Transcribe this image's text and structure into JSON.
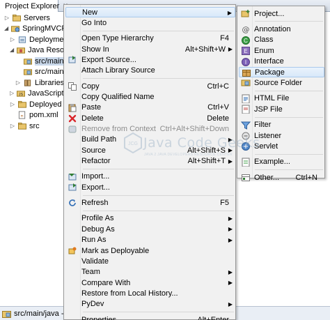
{
  "explorer": {
    "tab_title": "Project Explorer",
    "tree": [
      {
        "label": "Servers",
        "icon": "folder-icon",
        "indent": 0,
        "twisty": "closed"
      },
      {
        "label": "SpringMVCRed",
        "icon": "web-project-icon",
        "indent": 0,
        "twisty": "open"
      },
      {
        "label": "Deploymen",
        "icon": "deployment-icon",
        "indent": 1,
        "twisty": "closed"
      },
      {
        "label": "Java Resour",
        "icon": "java-resources-icon",
        "indent": 1,
        "twisty": "open"
      },
      {
        "label": "src/main/",
        "icon": "source-folder-icon",
        "indent": 2,
        "twisty": "none",
        "selected": true
      },
      {
        "label": "src/main/",
        "icon": "source-folder-icon",
        "indent": 2,
        "twisty": "none"
      },
      {
        "label": "Libraries",
        "icon": "libraries-icon",
        "indent": 2,
        "twisty": "closed"
      },
      {
        "label": "JavaScript R",
        "icon": "javascript-icon",
        "indent": 1,
        "twisty": "closed"
      },
      {
        "label": "Deployed R",
        "icon": "folder-icon",
        "indent": 1,
        "twisty": "closed"
      },
      {
        "label": "pom.xml",
        "icon": "xml-file-icon",
        "indent": 1,
        "twisty": "none"
      },
      {
        "label": "src",
        "icon": "folder-icon",
        "indent": 1,
        "twisty": "closed"
      }
    ],
    "status_text": "src/main/java - Spring"
  },
  "context_menu": {
    "items": [
      {
        "label": "New",
        "accel": "",
        "submenu": true,
        "highlighted": true,
        "icon": ""
      },
      {
        "label": "Go Into",
        "accel": "",
        "icon": ""
      },
      {
        "sep": true
      },
      {
        "label": "Open Type Hierarchy",
        "accel": "F4",
        "icon": ""
      },
      {
        "label": "Show In",
        "accel": "Alt+Shift+W",
        "submenu": true,
        "icon": ""
      },
      {
        "label": "Export Source...",
        "accel": "",
        "icon": "export-source-icon"
      },
      {
        "label": "Attach Library Source",
        "accel": "",
        "icon": ""
      },
      {
        "sep": true
      },
      {
        "label": "Copy",
        "accel": "Ctrl+C",
        "icon": "copy-icon"
      },
      {
        "label": "Copy Qualified Name",
        "accel": "",
        "icon": ""
      },
      {
        "label": "Paste",
        "accel": "Ctrl+V",
        "icon": "paste-icon"
      },
      {
        "label": "Delete",
        "accel": "Delete",
        "icon": "delete-icon"
      },
      {
        "label": "Remove from Context",
        "accel": "Ctrl+Alt+Shift+Down",
        "disabled": true,
        "icon": "remove-context-icon"
      },
      {
        "label": "Build Path",
        "accel": "",
        "submenu": true,
        "icon": ""
      },
      {
        "label": "Source",
        "accel": "Alt+Shift+S",
        "submenu": true,
        "icon": ""
      },
      {
        "label": "Refactor",
        "accel": "Alt+Shift+T",
        "submenu": true,
        "icon": ""
      },
      {
        "sep": true
      },
      {
        "label": "Import...",
        "accel": "",
        "icon": "import-icon"
      },
      {
        "label": "Export...",
        "accel": "",
        "icon": "export-icon"
      },
      {
        "sep": true
      },
      {
        "label": "Refresh",
        "accel": "F5",
        "icon": "refresh-icon"
      },
      {
        "sep": true
      },
      {
        "label": "Profile As",
        "accel": "",
        "submenu": true,
        "icon": ""
      },
      {
        "label": "Debug As",
        "accel": "",
        "submenu": true,
        "icon": ""
      },
      {
        "label": "Run As",
        "accel": "",
        "submenu": true,
        "icon": ""
      },
      {
        "label": "Mark as Deployable",
        "accel": "",
        "icon": "deployable-icon"
      },
      {
        "label": "Validate",
        "accel": "",
        "icon": ""
      },
      {
        "label": "Team",
        "accel": "",
        "submenu": true,
        "icon": ""
      },
      {
        "label": "Compare With",
        "accel": "",
        "submenu": true,
        "icon": ""
      },
      {
        "label": "Restore from Local History...",
        "accel": "",
        "icon": ""
      },
      {
        "label": "PyDev",
        "accel": "",
        "submenu": true,
        "icon": ""
      },
      {
        "sep": true
      },
      {
        "label": "Properties",
        "accel": "Alt+Enter",
        "icon": ""
      }
    ]
  },
  "new_submenu": {
    "items": [
      {
        "label": "Project...",
        "accel": "",
        "icon": "project-icon"
      },
      {
        "sep": true
      },
      {
        "label": "Annotation",
        "accel": "",
        "icon": "annotation-icon"
      },
      {
        "label": "Class",
        "accel": "",
        "icon": "class-icon"
      },
      {
        "label": "Enum",
        "accel": "",
        "icon": "enum-icon"
      },
      {
        "label": "Interface",
        "accel": "",
        "icon": "interface-icon"
      },
      {
        "label": "Package",
        "accel": "",
        "icon": "package-icon",
        "highlighted": true
      },
      {
        "label": "Source Folder",
        "accel": "",
        "icon": "source-folder-icon"
      },
      {
        "sep": true
      },
      {
        "label": "HTML File",
        "accel": "",
        "icon": "html-file-icon"
      },
      {
        "label": "JSP File",
        "accel": "",
        "icon": "jsp-file-icon"
      },
      {
        "sep": true
      },
      {
        "label": "Filter",
        "accel": "",
        "icon": "filter-icon"
      },
      {
        "label": "Listener",
        "accel": "",
        "icon": "listener-icon"
      },
      {
        "label": "Servlet",
        "accel": "",
        "icon": "servlet-icon"
      },
      {
        "sep": true
      },
      {
        "label": "Example...",
        "accel": "",
        "icon": "example-icon"
      },
      {
        "sep": true
      },
      {
        "label": "Other...",
        "accel": "Ctrl+N",
        "icon": "other-icon"
      }
    ]
  },
  "watermark": {
    "title": "Java Code Geeks",
    "subtitle": "JAVA 2 JAVA DEVELOPERS RESOURCE CENTER",
    "badge": "JCG"
  },
  "colors": {
    "menu_bg": "#f1f1f1",
    "highlight": "#d8e8f9",
    "highlight_border": "#a9c9ec",
    "disabled_text": "#8d8d8d"
  }
}
